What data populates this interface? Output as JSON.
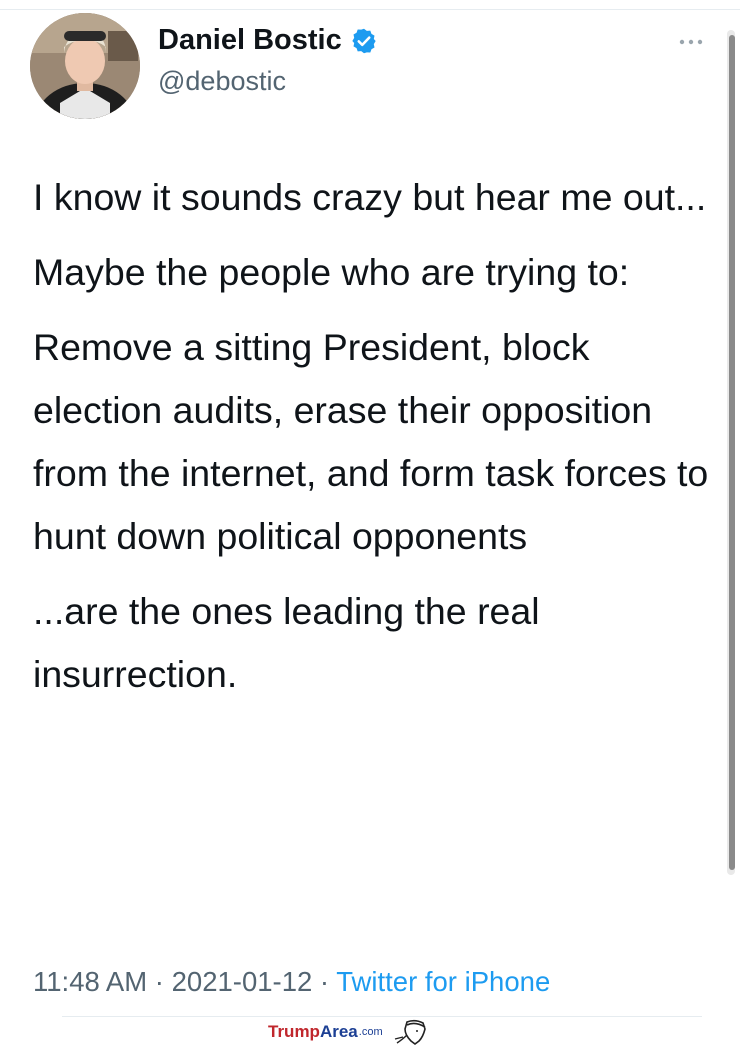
{
  "tweet": {
    "author": {
      "display_name": "Daniel Bostic",
      "handle": "@debostic",
      "verified": true
    },
    "paragraphs": [
      "I know it sounds crazy but hear me out...",
      "Maybe the people who are trying to:",
      "Remove a sitting President, block election audits, erase their opposition from the internet, and form task forces to hunt down political opponents",
      "...are the ones leading the real insurrection."
    ],
    "meta": {
      "time": "11:48 AM",
      "date": "2021-01-12",
      "separator": "·",
      "source": "Twitter for iPhone"
    }
  },
  "icons": {
    "verified": "verified-badge-icon",
    "more": "more-options-icon"
  },
  "watermark": {
    "part1": "Trump",
    "part2": "Area",
    "suffix": ".com"
  },
  "colors": {
    "verified_blue": "#1d9bf0",
    "secondary_text": "#536471",
    "link": "#1d9bf0",
    "watermark_red": "#c0272d",
    "watermark_blue": "#1c3f94"
  }
}
